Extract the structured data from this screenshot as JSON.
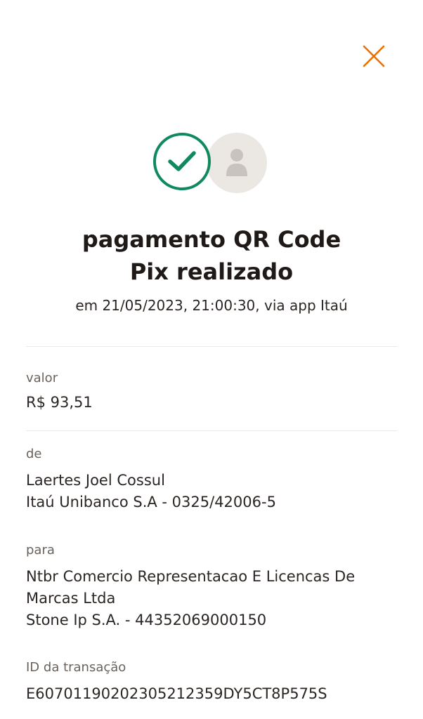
{
  "header": {
    "close_icon": "close-x-icon",
    "accent_color": "#ec7000"
  },
  "status": {
    "icon": "check-circle-icon",
    "avatar_icon": "person-icon",
    "success_color": "#0f8a5f",
    "title_line1": "pagamento QR Code",
    "title_line2": "Pix realizado",
    "subtitle": "em 21/05/2023, 21:00:30, via app Itaú"
  },
  "details": {
    "valor": {
      "label": "valor",
      "value": "R$ 93,51"
    },
    "de": {
      "label": "de",
      "name": "Laertes Joel Cossul",
      "bank": "Itaú Unibanco S.A - 0325/42006-5"
    },
    "para": {
      "label": "para",
      "name": "Ntbr Comercio Representacao E Licencas De Marcas Ltda",
      "bank": "Stone Ip S.A. - 44352069000150"
    },
    "transacao": {
      "label": "ID da transação",
      "value": "E60701190202305212359DY5CT8P575S"
    }
  }
}
